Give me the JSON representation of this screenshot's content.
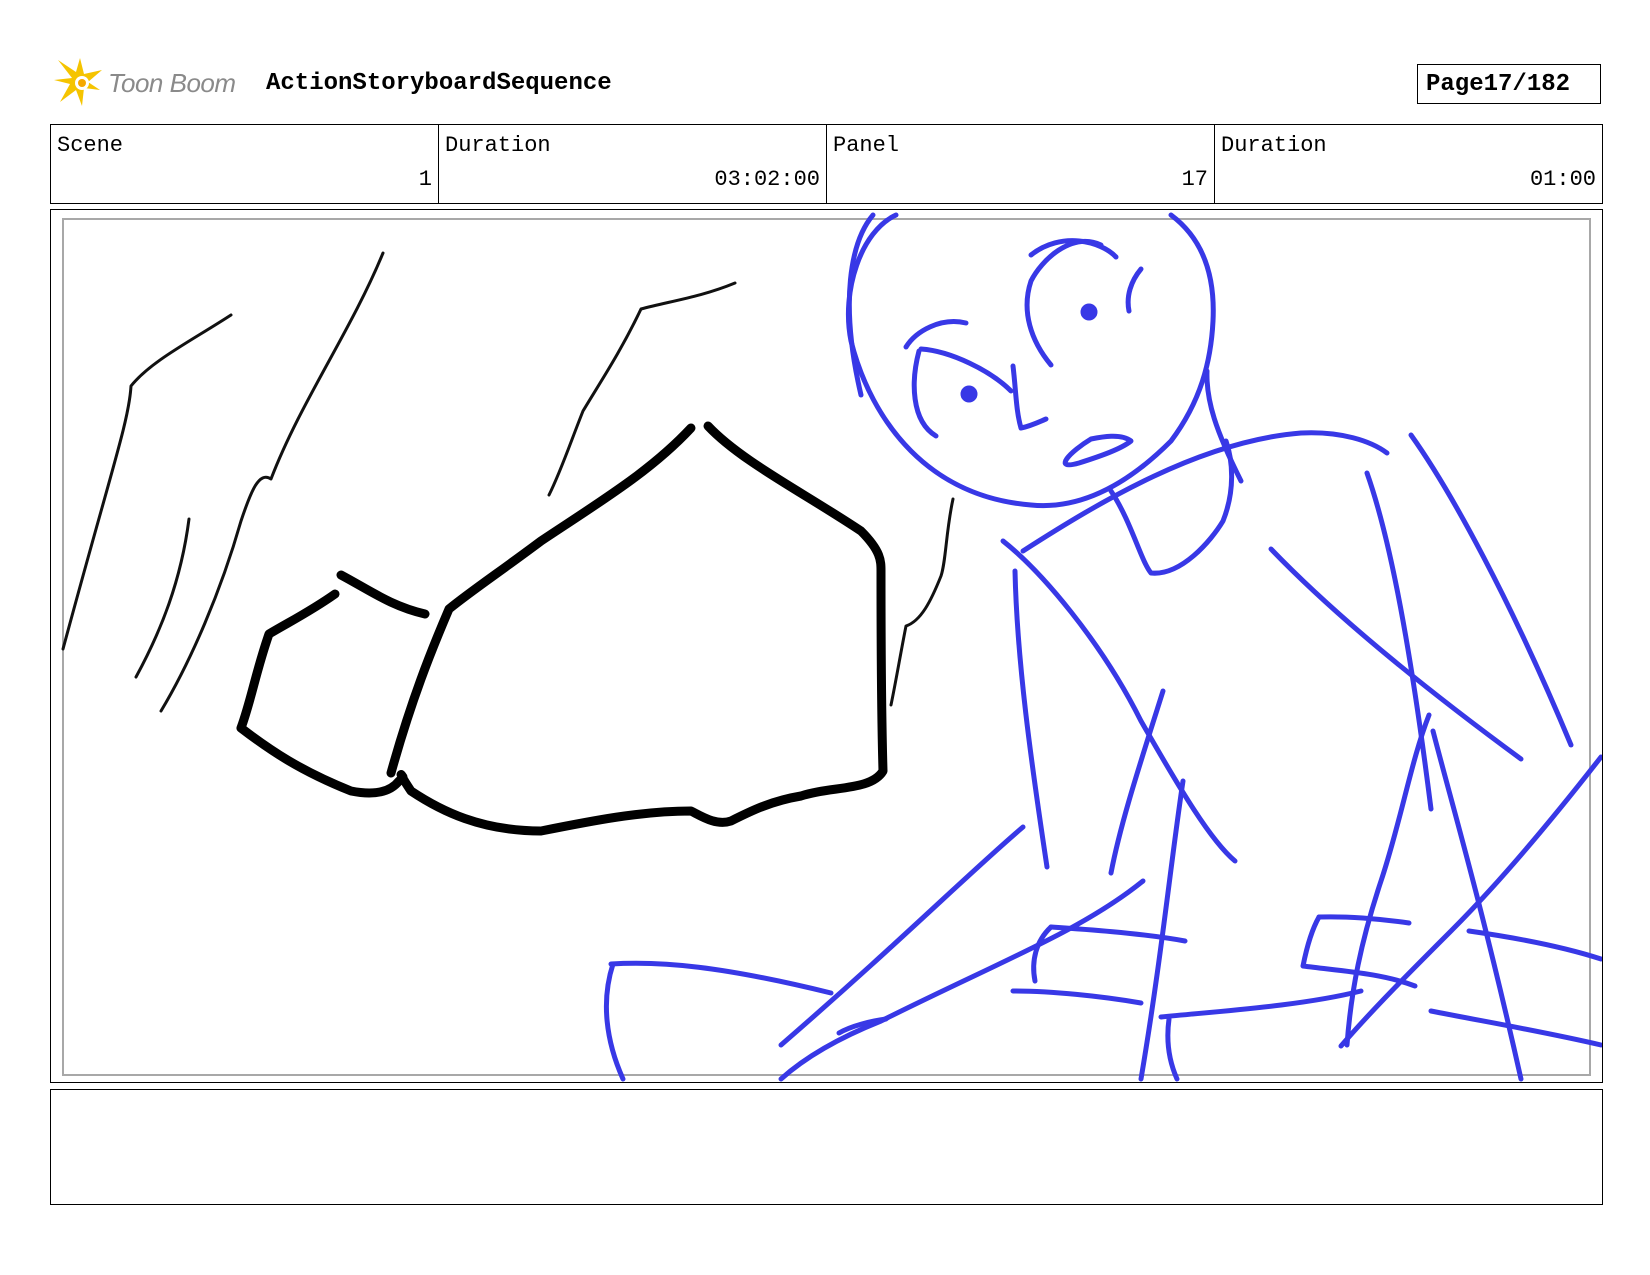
{
  "header": {
    "logo_text": "Toon Boom",
    "title": "ActionStoryboardSequence",
    "page_label": "Page",
    "page_value": "17/182"
  },
  "info": [
    {
      "label": "Scene",
      "value": "1"
    },
    {
      "label": "Duration",
      "value": "03:02:00"
    },
    {
      "label": "Panel",
      "value": "17"
    },
    {
      "label": "Duration",
      "value": "01:00"
    }
  ],
  "panel": {
    "ink_colors": {
      "fist": "#000000",
      "figure": "#3838e6"
    }
  },
  "notes": {
    "text": ""
  },
  "icons": {
    "logo": "toon-boom-star-icon"
  }
}
